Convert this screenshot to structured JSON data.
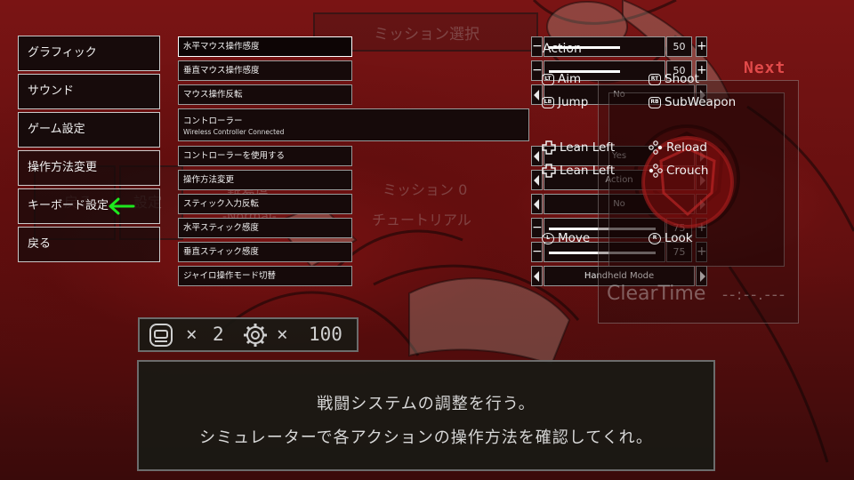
{
  "menu": {
    "items": [
      {
        "label": "グラフィック"
      },
      {
        "label": "サウンド"
      },
      {
        "label": "ゲーム設定"
      },
      {
        "label": "操作方法変更"
      },
      {
        "label": "キーボード設定"
      },
      {
        "label": "戻る"
      }
    ]
  },
  "settings": {
    "h_mouse": {
      "label": "水平マウス操作感度",
      "value": "50",
      "level": 0.5
    },
    "v_mouse": {
      "label": "垂直マウス操作感度",
      "value": "50",
      "level": 0.5
    },
    "mouse_invert": {
      "label": "マウス操作反転",
      "value": "No"
    },
    "controller": {
      "label": "コントローラー",
      "status": "Wireless Controller Connected"
    },
    "use_controller": {
      "label": "コントローラーを使用する",
      "value": "Yes"
    },
    "control_scheme": {
      "label": "操作方法変更",
      "value": "Action"
    },
    "stick_invert": {
      "label": "スティック入力反転",
      "value": "No"
    },
    "h_stick": {
      "label": "水平スティック感度",
      "value": "75",
      "level": 0.75
    },
    "v_stick": {
      "label": "垂直スティック感度",
      "value": "75",
      "level": 0.75
    },
    "gyro": {
      "label": "ジャイロ操作モード切替",
      "value": "Handheld Mode"
    },
    "minus_symbol": "−",
    "plus_symbol": "+"
  },
  "controls_panel": {
    "title": "Action",
    "items": [
      {
        "icon": "LT",
        "label": "Aim"
      },
      {
        "icon": "RT",
        "label": "Shoot"
      },
      {
        "icon": "LB",
        "label": "Jump"
      },
      {
        "icon": "RB",
        "label": "SubWeapon"
      },
      {
        "icon": "dpad",
        "label": "Lean Left"
      },
      {
        "icon": "face-buttons",
        "label": "Reload"
      },
      {
        "icon": "dpad",
        "label": "Lean Left"
      },
      {
        "icon": "face-buttons",
        "label": "Crouch"
      },
      {
        "icon": "L",
        "label": "Move"
      },
      {
        "icon": "R",
        "label": "Look"
      }
    ]
  },
  "background": {
    "mission_select": "ミッション選択",
    "next_label": "Next",
    "cleartime_label": "ClearTime",
    "cleartime_value": "--:--.---",
    "back_ghost": "戻る",
    "settings_ghost": "設定",
    "difficulty_ghost": "難易度",
    "difficulty_value_ghost": "-Normal-",
    "mission_ghost": "ミッション 0",
    "tutorial_ghost": "チュートリアル"
  },
  "stock": {
    "times_a": "×",
    "count_a": "2",
    "times_b": "×",
    "count_b": "100"
  },
  "message": {
    "line1": "戦闘システムの調整を行う。",
    "line2": "シミュレーターで各アクションの操作方法を確認してくれ。"
  },
  "colors": {
    "accent_arrow": "#1ee81e",
    "next": "#e24a4a",
    "bg_red": "#6a1111"
  }
}
